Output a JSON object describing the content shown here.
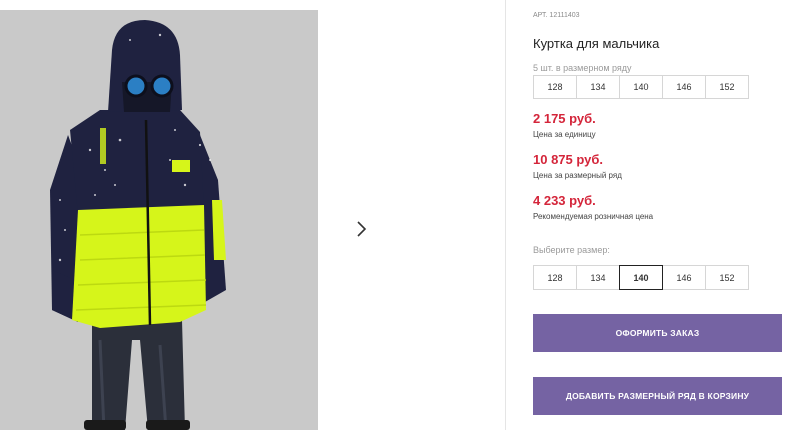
{
  "product": {
    "art_prefix": "АРТ.",
    "art_number": "12111403",
    "title": "Куртка для мальчика"
  },
  "pack_hint": "5 шт. в размерном ряду",
  "size_row_sizes": [
    "128",
    "134",
    "140",
    "146",
    "152"
  ],
  "prices": [
    {
      "value": "2 175 руб.",
      "label": "Цена за единицу"
    },
    {
      "value": "10 875 руб.",
      "label": "Цена за размерный ряд"
    },
    {
      "value": "4 233 руб.",
      "label": "Рекомендуемая розничная цена"
    }
  ],
  "size_select": {
    "label": "Выберите размер:",
    "options": [
      "128",
      "134",
      "140",
      "146",
      "152"
    ],
    "selected": "140"
  },
  "buttons": {
    "order": "ОФОРМИТЬ ЗАКАЗ",
    "add_to_cart": "ДОБАВИТЬ РАЗМЕРНЫЙ РЯД В КОРЗИНУ"
  },
  "icons": {
    "next": "chevron-right-icon"
  },
  "colors": {
    "price": "#d4253a",
    "button": "#7563a3",
    "photo_bg": "#c9c9c9",
    "jacket_navy": "#1f2240",
    "jacket_lime": "#d6f51a"
  }
}
